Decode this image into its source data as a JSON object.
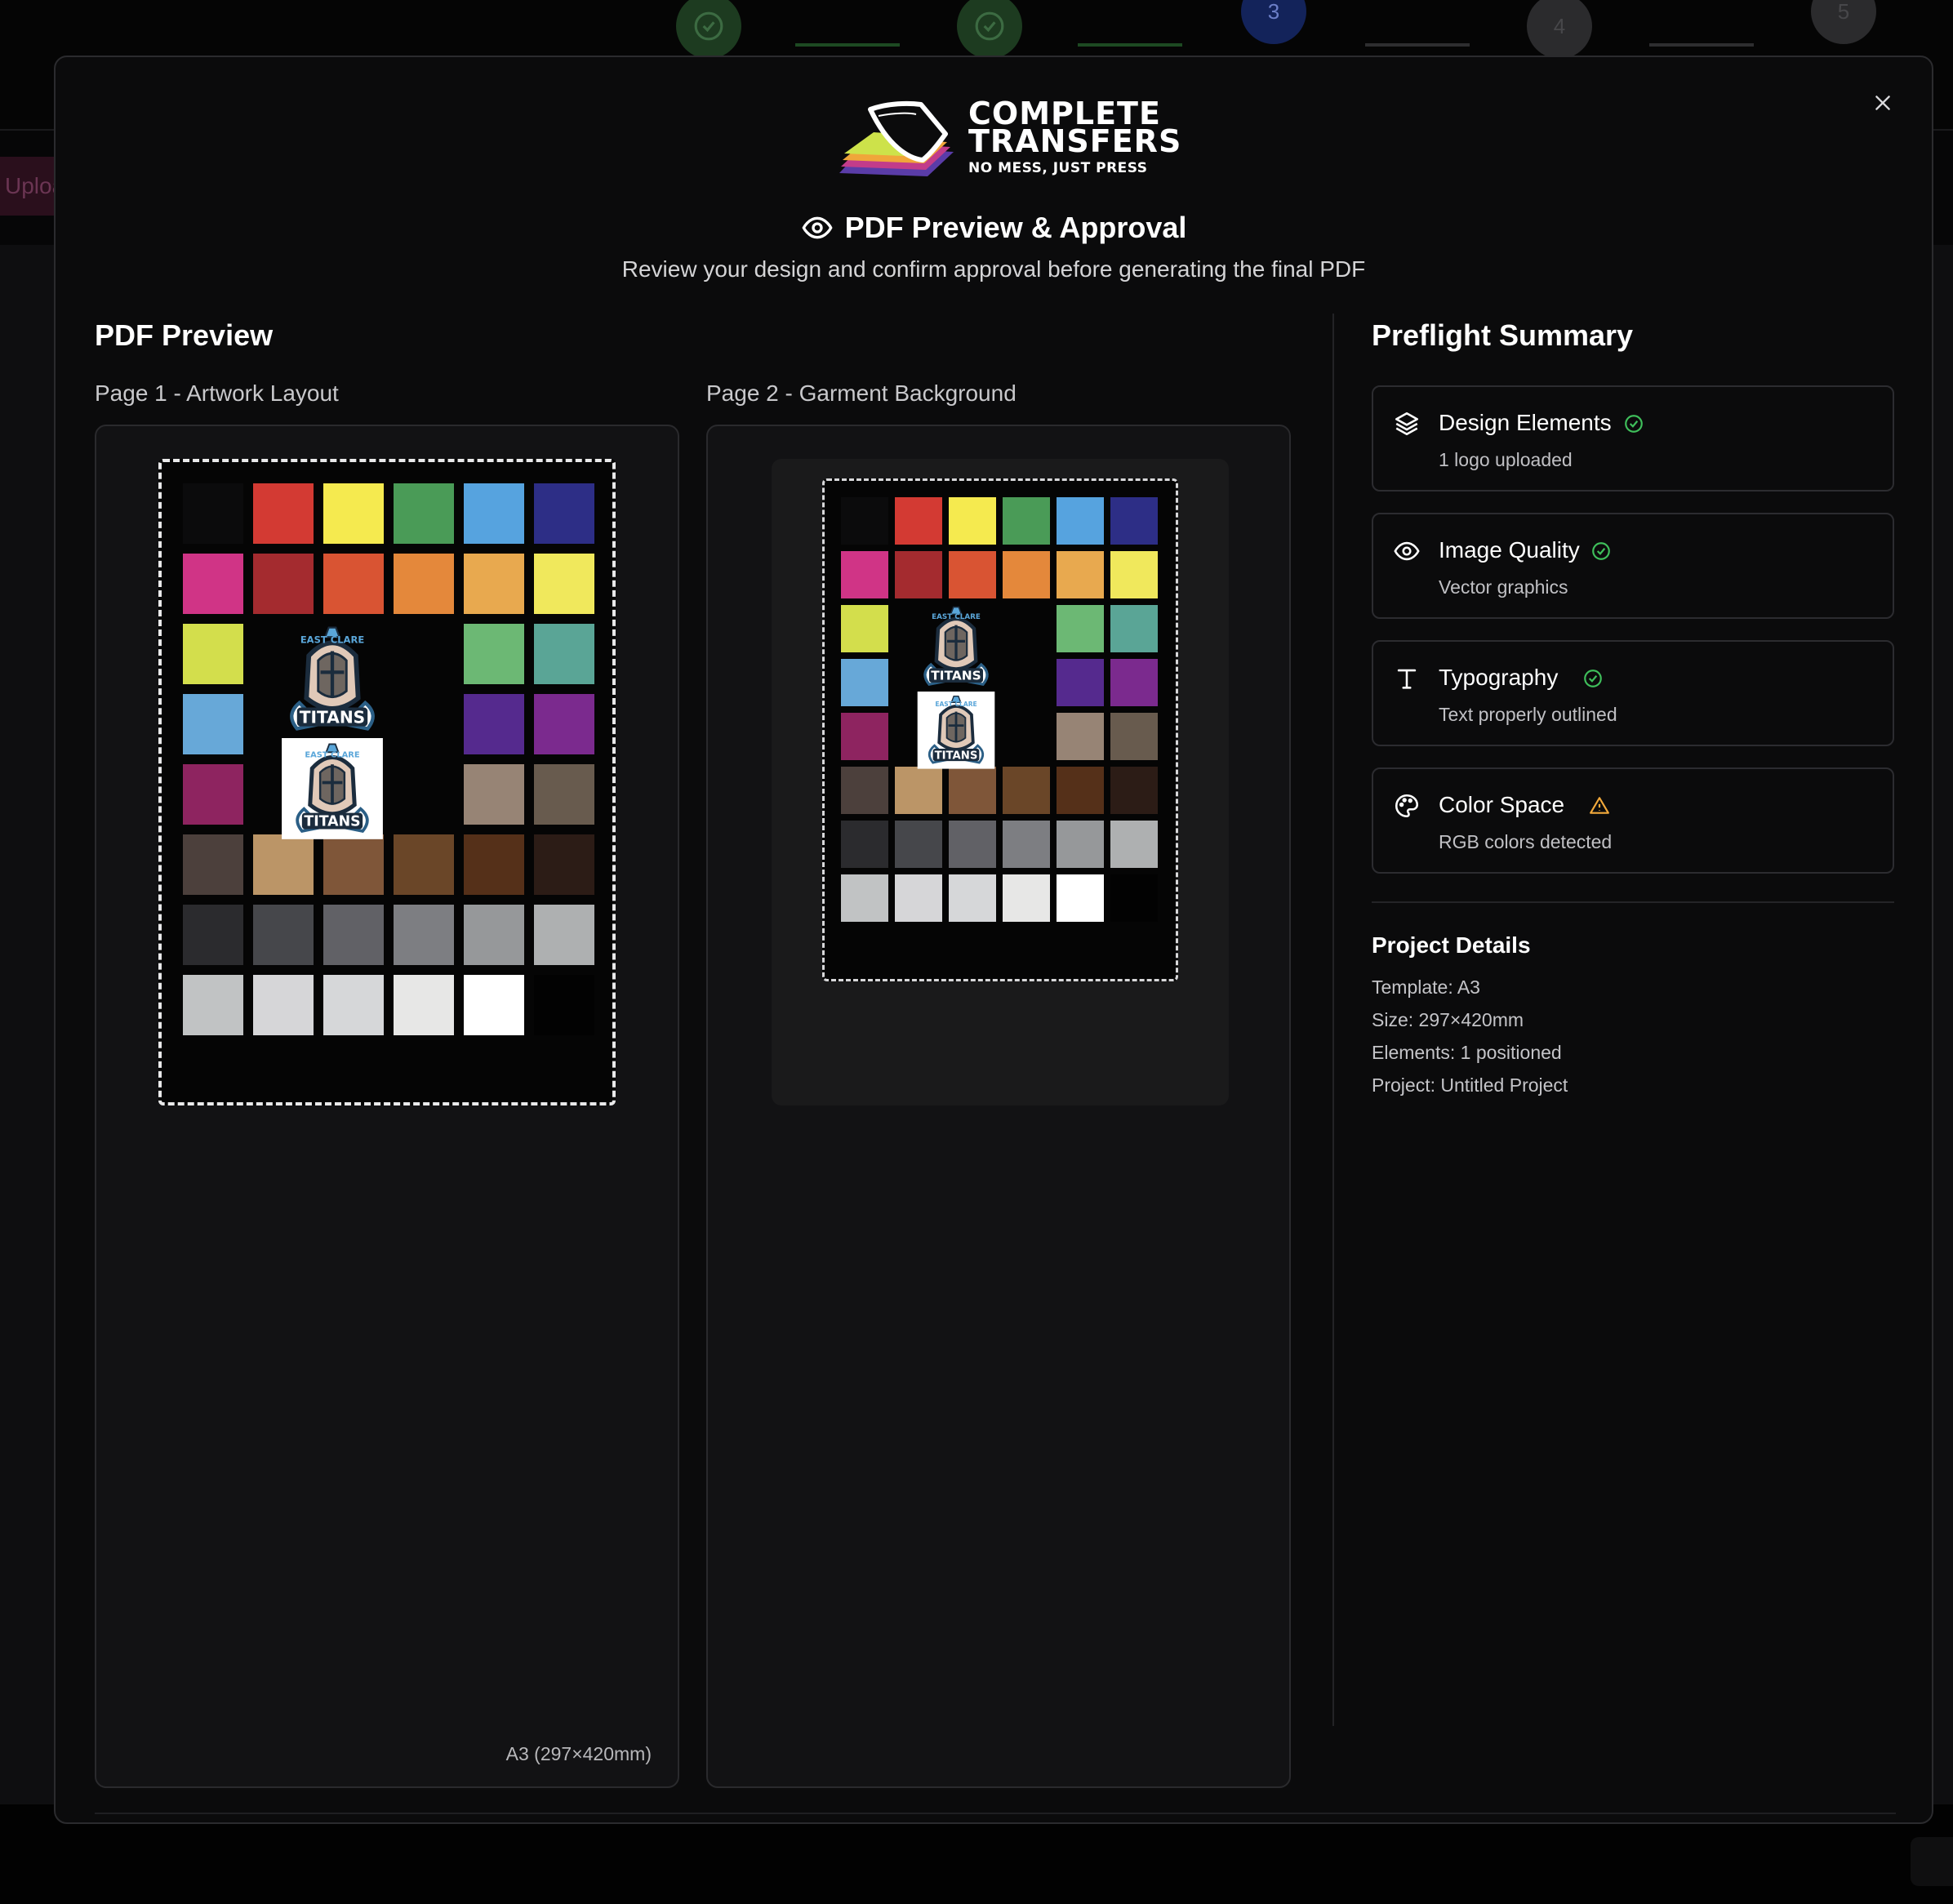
{
  "background": {
    "steps": [
      {
        "state": "done",
        "label": ""
      },
      {
        "state": "done",
        "label": ""
      },
      {
        "state": "active",
        "label": "3"
      },
      {
        "state": "todo",
        "label": "4"
      },
      {
        "state": "todo",
        "label": "5"
      }
    ],
    "upload_tab": "Upload"
  },
  "modal": {
    "brand": {
      "line1": "COMPLETE",
      "line2": "TRANSFERS",
      "tagline": "NO MESS, JUST PRESS"
    },
    "title": "PDF Preview & Approval",
    "subtitle": "Review your design and confirm approval before generating the final PDF",
    "close_icon": "close-icon"
  },
  "preview": {
    "heading": "PDF Preview",
    "page1": {
      "label": "Page 1 - Artwork Layout",
      "size": "A3 (297×420mm)"
    },
    "page2": {
      "label": "Page 2 - Garment Background"
    },
    "logo_text": {
      "top": "EAST CLARE",
      "bottom": "TITANS"
    },
    "swatch_rows": [
      [
        "#0b0b0c",
        "#d33a33",
        "#f5ea4f",
        "#4a9b57",
        "#56a3df",
        "#2d2e86"
      ],
      [
        "#d03486",
        "#a42b2f",
        "#d95433",
        "#e4883b",
        "#e8a94f",
        "#f0e85c"
      ],
      [
        "#d3de4c",
        "",
        "",
        "",
        "#6cb874",
        "#5aa596"
      ],
      [
        "#67a8d8",
        "",
        "",
        "",
        "#552a8e",
        "#7b2a8e"
      ],
      [
        "#8e2460",
        "",
        "",
        "",
        "#978475",
        "#685b4e"
      ],
      [
        "#4c403c",
        "#bb9567",
        "#7f5639",
        "#6a4628",
        "#553019",
        "#2c1c16"
      ],
      [
        "#2b2b2e",
        "#46474b",
        "#616166",
        "#7d7e82",
        "#96989a",
        "#aeb0b1"
      ],
      [
        "#c1c3c4",
        "#d6d6d8",
        "#d6d7d9",
        "#e7e7e6",
        "#ffffff",
        "#020202"
      ]
    ],
    "garment_color": "#1a1a1b"
  },
  "preflight": {
    "heading": "Preflight Summary",
    "items": [
      {
        "icon": "layers-icon",
        "title": "Design Elements",
        "desc": "1 logo uploaded",
        "status": "ok"
      },
      {
        "icon": "eye-icon",
        "title": "Image Quality",
        "desc": "Vector graphics",
        "status": "ok"
      },
      {
        "icon": "type-icon",
        "title": "Typography",
        "desc": "Text properly outlined",
        "status": "ok"
      },
      {
        "icon": "palette-icon",
        "title": "Color Space",
        "desc": "RGB colors detected",
        "status": "warning"
      }
    ],
    "status_colors": {
      "ok": "#3fbf5b",
      "warning": "#f2a93b"
    }
  },
  "project": {
    "heading": "Project Details",
    "template": "Template: A3",
    "size": "Size: 297×420mm",
    "elements": "Elements: 1 positioned",
    "project": "Project: Untitled Project"
  }
}
